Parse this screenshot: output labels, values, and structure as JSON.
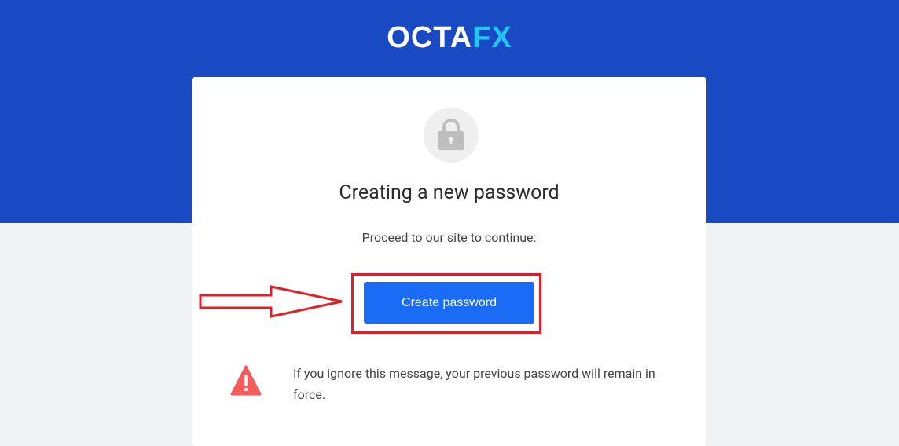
{
  "header": {
    "logo_part1": "OCTA",
    "logo_part2": "FX"
  },
  "card": {
    "title": "Creating a new password",
    "subtitle": "Proceed to our site to continue:",
    "button_label": "Create password",
    "warning": "If you ignore this message, your previous password will remain in force."
  },
  "icons": {
    "lock": "lock-icon",
    "warning": "warning-triangle-icon",
    "arrow": "arrow-right-annotation"
  },
  "colors": {
    "header_bg": "#1a4ac3",
    "button_bg": "#1a6cf7",
    "annotation_red": "#e01e26",
    "logo_accent": "#22c5f3",
    "warning_red": "#f25c5c"
  }
}
